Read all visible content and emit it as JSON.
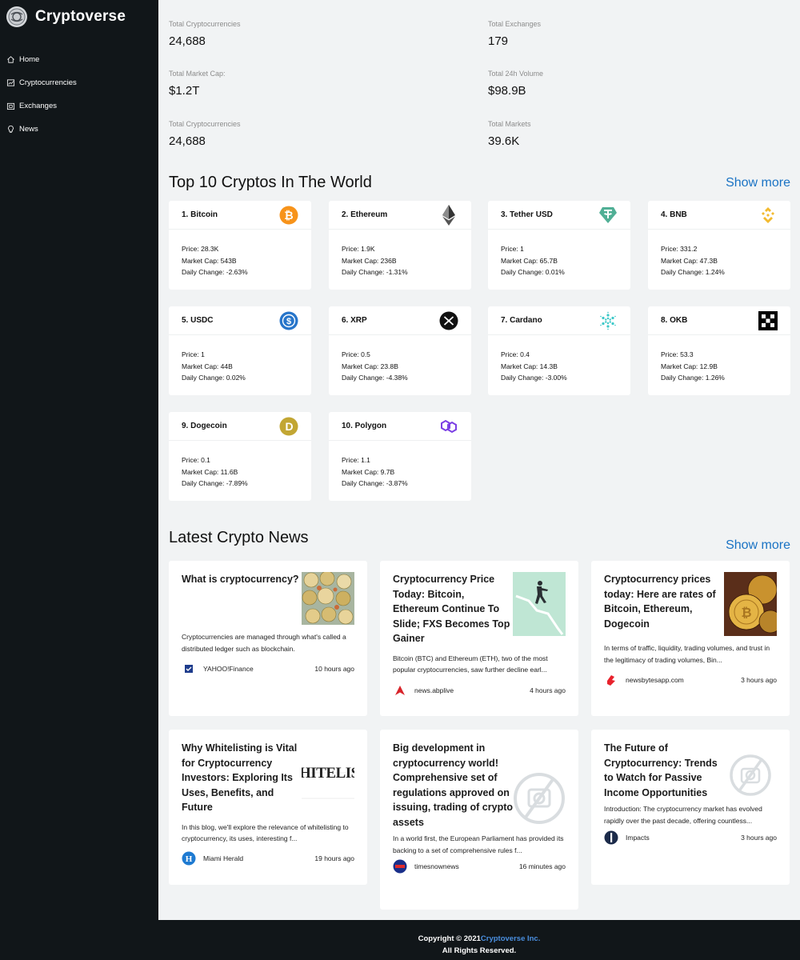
{
  "brand": {
    "title": "Cryptoverse"
  },
  "menu": [
    {
      "label": "Home",
      "icon": "home-icon"
    },
    {
      "label": "Cryptocurrencies",
      "icon": "chart-icon"
    },
    {
      "label": "Exchanges",
      "icon": "wallet-icon"
    },
    {
      "label": "News",
      "icon": "bulb-icon"
    }
  ],
  "stats": [
    {
      "label": "Total Cryptocurrencies",
      "value": "24,688"
    },
    {
      "label": "Total Exchanges",
      "value": "179"
    },
    {
      "label": "Total Market Cap:",
      "value": "$1.2T"
    },
    {
      "label": "Total 24h Volume",
      "value": "$98.9B"
    },
    {
      "label": "Total Cryptocurrencies",
      "value": "24,688"
    },
    {
      "label": "Total Markets",
      "value": "39.6K"
    }
  ],
  "top_section": {
    "title": "Top 10 Cryptos In The World",
    "show_more": "Show more"
  },
  "coins": [
    {
      "name": "1. Bitcoin",
      "price": "Price: 28.3K",
      "cap": "Market Cap: 543B",
      "change": "Daily Change: -2.63%",
      "icon": "bitcoin-icon"
    },
    {
      "name": "2. Ethereum",
      "price": "Price: 1.9K",
      "cap": "Market Cap: 236B",
      "change": "Daily Change: -1.31%",
      "icon": "ethereum-icon"
    },
    {
      "name": "3. Tether USD",
      "price": "Price: 1",
      "cap": "Market Cap: 65.7B",
      "change": "Daily Change: 0.01%",
      "icon": "tether-icon"
    },
    {
      "name": "4. BNB",
      "price": "Price: 331.2",
      "cap": "Market Cap: 47.3B",
      "change": "Daily Change: 1.24%",
      "icon": "bnb-icon"
    },
    {
      "name": "5. USDC",
      "price": "Price: 1",
      "cap": "Market Cap: 44B",
      "change": "Daily Change: 0.02%",
      "icon": "usdc-icon"
    },
    {
      "name": "6. XRP",
      "price": "Price: 0.5",
      "cap": "Market Cap: 23.8B",
      "change": "Daily Change: -4.38%",
      "icon": "xrp-icon"
    },
    {
      "name": "7. Cardano",
      "price": "Price: 0.4",
      "cap": "Market Cap: 14.3B",
      "change": "Daily Change: -3.00%",
      "icon": "cardano-icon"
    },
    {
      "name": "8. OKB",
      "price": "Price: 53.3",
      "cap": "Market Cap: 12.9B",
      "change": "Daily Change: 1.26%",
      "icon": "okb-icon"
    },
    {
      "name": "9. Dogecoin",
      "price": "Price: 0.1",
      "cap": "Market Cap: 11.6B",
      "change": "Daily Change: -7.89%",
      "icon": "dogecoin-icon"
    },
    {
      "name": "10. Polygon",
      "price": "Price: 1.1",
      "cap": "Market Cap: 9.7B",
      "change": "Daily Change: -3.87%",
      "icon": "polygon-icon"
    }
  ],
  "news_section": {
    "title": "Latest Crypto News",
    "show_more": "Show more"
  },
  "news": [
    {
      "title": "What is cryptocurrency?",
      "desc": "Cryptocurrencies are managed through what's called a distributed ledger such as blockchain.",
      "provider": "YAHOO!Finance",
      "time": "10 hours ago"
    },
    {
      "title": "Cryptocurrency Price Today: Bitcoin, Ethereum Continue To Slide; FXS Becomes Top Gainer",
      "desc": "Bitcoin (BTC) and Ethereum (ETH), two of the most popular cryptocurrencies, saw further decline earl...",
      "provider": "news.abplive",
      "time": "4 hours ago"
    },
    {
      "title": "Cryptocurrency prices today: Here are rates of Bitcoin, Ethereum, Dogecoin",
      "desc": "In terms of traffic, liquidity, trading volumes, and trust in the legitimacy of trading volumes, Bin...",
      "provider": "newsbytesapp.com",
      "time": "3 hours ago"
    },
    {
      "title": "Why Whitelisting is Vital for Cryptocurrency Investors: Exploring Its Uses, Benefits, and Future",
      "desc": "In this blog, we'll explore the relevance of whitelisting to cryptocurrency, its uses, interesting f...",
      "provider": "Miami Herald",
      "time": "19 hours ago",
      "img_text": "HITELISTI"
    },
    {
      "title": "Big development in cryptocurrency world! Comprehensive set of regulations approved on issuing, trading of crypto assets",
      "desc": "In a world first, the European Parliament has provided its backing to a set of comprehensive rules f...",
      "provider": "timesnownews",
      "time": "16 minutes ago"
    },
    {
      "title": "The Future of Cryptocurrency: Trends to Watch for Passive Income Opportunities",
      "desc": "Introduction: The cryptocurrency market has evolved rapidly over the past decade, offering countless...",
      "provider": "Impacts",
      "time": "3 hours ago"
    }
  ],
  "footer": {
    "line1": "Copyright © 2021",
    "link": "Cryptoverse Inc.",
    "line2": "All Rights Reserved."
  }
}
